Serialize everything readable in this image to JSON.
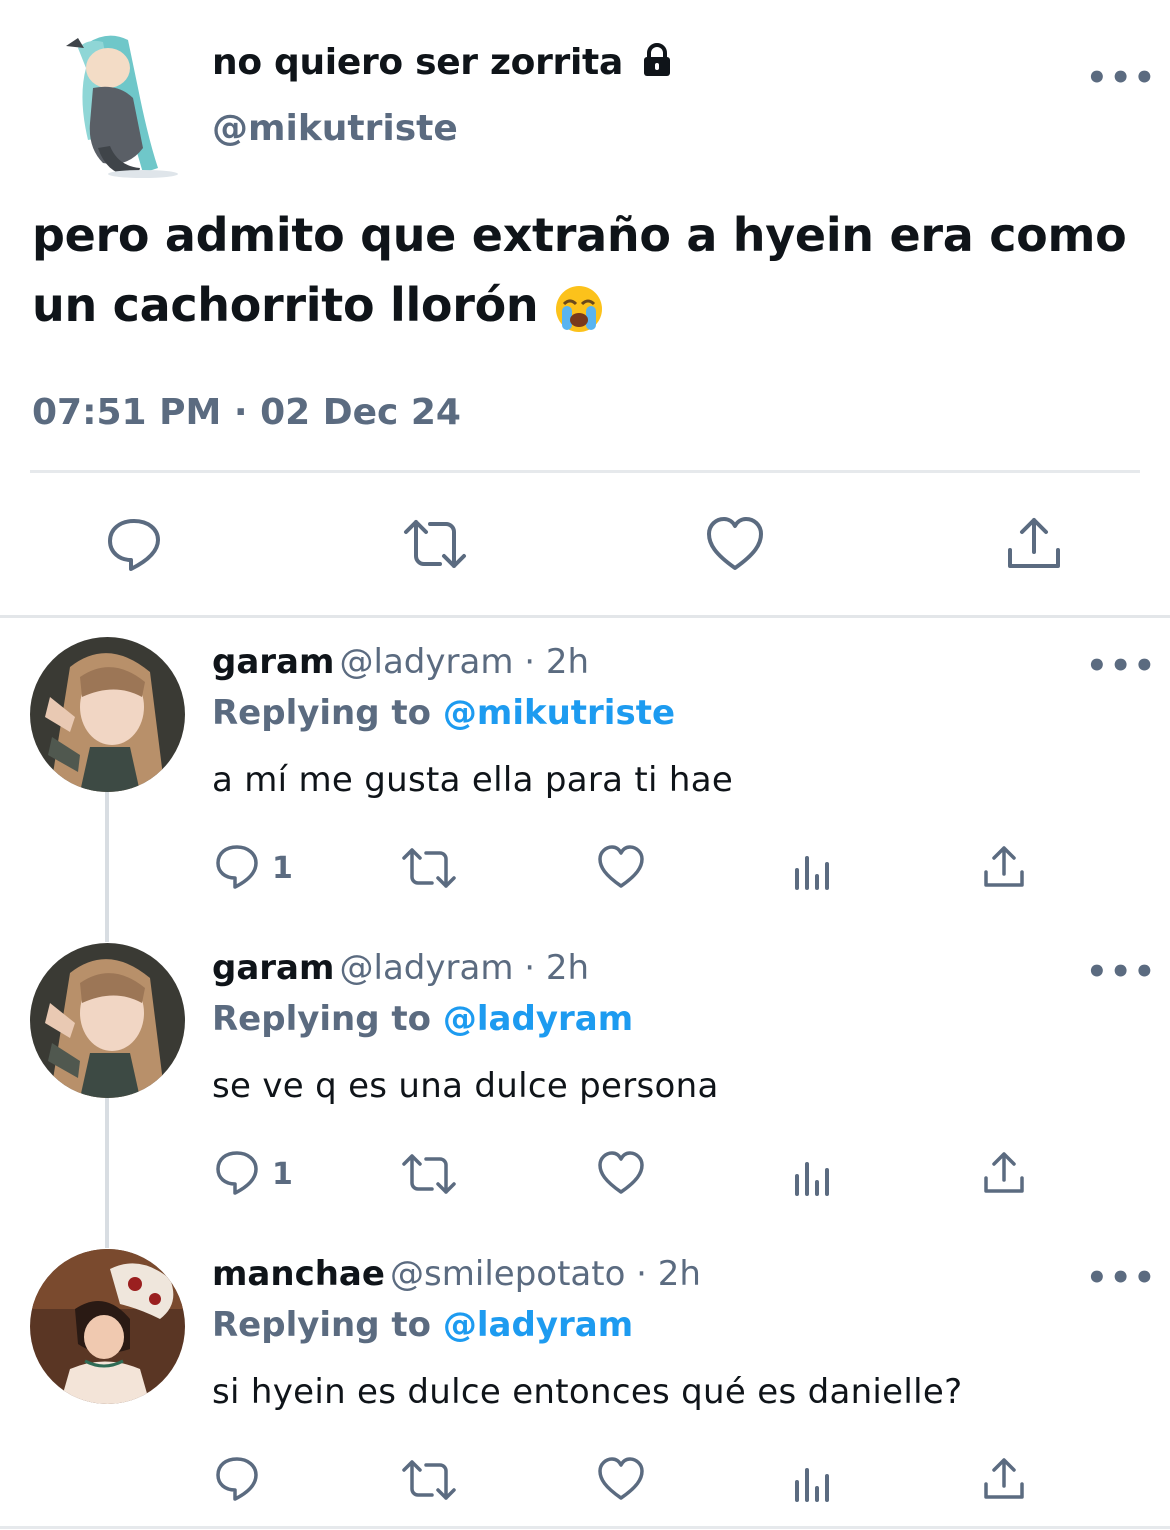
{
  "tweet": {
    "display_name": "no quiero ser zorrita",
    "lock_icon": "lock-icon",
    "handle": "@mikutriste",
    "text_line1": "pero admito que extraño a hyein era como",
    "text_line2": "un cachorrito llorón",
    "emoji": "crying-face-emoji",
    "timestamp": "07:51 PM · 02 Dec 24",
    "more": "•••"
  },
  "replies": [
    {
      "name": "garam",
      "handle": "@ladyram · 2h",
      "replying_prefix": "Replying to",
      "replying_to": "@mikutriste",
      "text": "a mí me gusta ella para ti hae",
      "reply_count": "1",
      "more": "•••"
    },
    {
      "name": "garam",
      "handle": "@ladyram · 2h",
      "replying_prefix": "Replying to",
      "replying_to": "@ladyram",
      "text": "se ve q es una dulce persona",
      "reply_count": "1",
      "more": "•••"
    },
    {
      "name": "manchae",
      "handle": "@smilepotato · 2h",
      "replying_prefix": "Replying to",
      "replying_to": "@ladyram",
      "text": "si hyein es dulce entonces qué es danielle?",
      "reply_count": "",
      "more": "•••"
    }
  ],
  "colors": {
    "accent": "#1d9bf0",
    "secondary_text": "#5b6b80",
    "primary_text": "#0f1419"
  }
}
